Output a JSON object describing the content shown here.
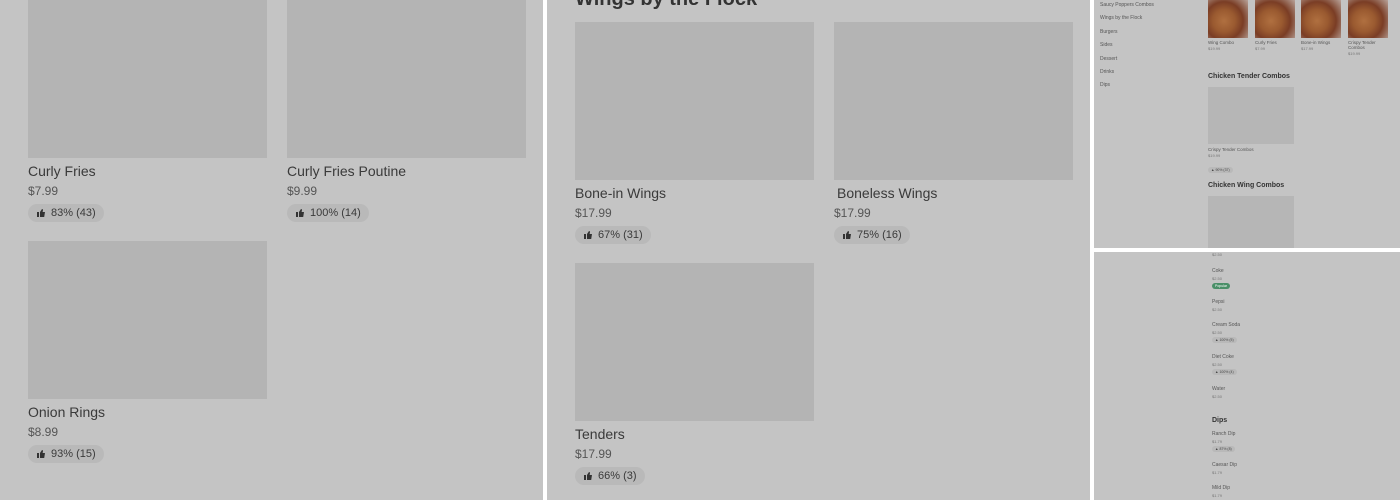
{
  "panel1": {
    "items": [
      {
        "name": "Curly Fries",
        "price": "$7.99",
        "rating": "83% (43)"
      },
      {
        "name": "Curly Fries Poutine",
        "price": "$9.99",
        "rating": "100% (14)"
      },
      {
        "name": "Onion Rings",
        "price": "$8.99",
        "rating": "93% (15)"
      }
    ]
  },
  "panel2": {
    "section_title": "Wings by the Flock",
    "items": [
      {
        "name": "Bone-in Wings",
        "price": "$17.99",
        "rating": "67% (31)"
      },
      {
        "name": "Boneless Wings",
        "price": "$17.99",
        "rating": "75% (16)"
      },
      {
        "name": "Tenders",
        "price": "$17.99",
        "rating": "66% (3)"
      }
    ]
  },
  "panel3": {
    "sidebar": [
      "Saucy Poppers Combos",
      "Wings by the Flock",
      "Burgers",
      "Sides",
      "Dessert",
      "Drinks",
      "Dips"
    ],
    "combos": [
      {
        "name": "Wing Combo",
        "price": "$19.99"
      },
      {
        "name": "Curly Fries",
        "price": "$7.99"
      },
      {
        "name": "Bone-in Wings",
        "price": "$17.99"
      },
      {
        "name": "Crispy Tender Combos",
        "price": "$19.99"
      }
    ],
    "section_tender": "Chicken Tender Combos",
    "tender_item": {
      "name": "Crispy Tender Combos",
      "price": "$19.99",
      "rating": "90% (37)"
    },
    "section_wing": "Chicken Wing Combos"
  },
  "panel4": {
    "top_price": "$2.50",
    "drinks": [
      {
        "name": "Coke",
        "price": "$2.50",
        "badge": "Popular"
      },
      {
        "name": "Pepsi",
        "price": "$2.50"
      },
      {
        "name": "Cream Soda",
        "price": "$2.50",
        "rating": "100% (5)"
      },
      {
        "name": "Diet Coke",
        "price": "$2.50",
        "rating": "100% (4)"
      },
      {
        "name": "Water",
        "price": "$2.50"
      }
    ],
    "section_dips": "Dips",
    "dips": [
      {
        "name": "Ranch Dip",
        "price": "$1.79",
        "rating": "87% (8)"
      },
      {
        "name": "Caesar Dip",
        "price": "$1.79"
      },
      {
        "name": "Mild Dip",
        "price": "$1.79"
      }
    ]
  }
}
